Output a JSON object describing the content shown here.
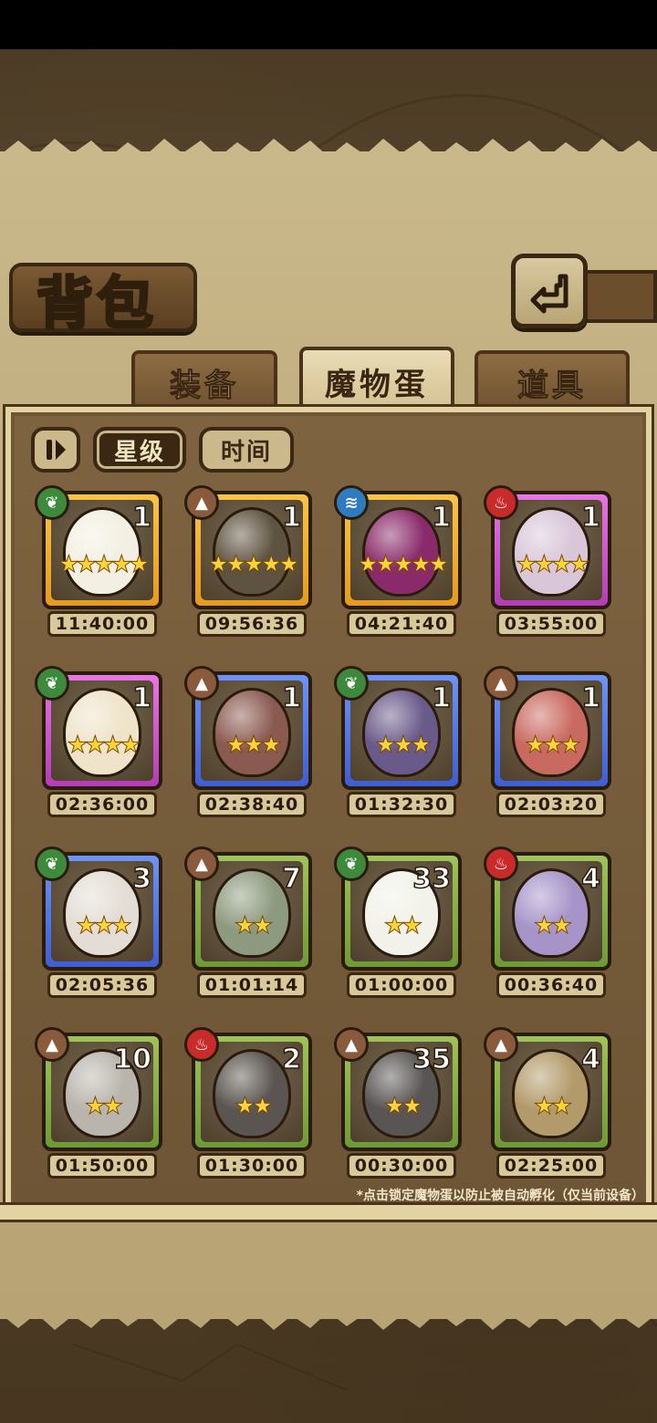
{
  "screen": {
    "title": "背包",
    "back_icon": "back-arrow-icon"
  },
  "tabs": [
    {
      "label": "装备",
      "active": false
    },
    {
      "label": "魔物蛋",
      "active": true
    },
    {
      "label": "道具",
      "active": false
    }
  ],
  "sort": {
    "toggle_icon": "sort-toggle-icon",
    "star_label": "星级",
    "time_label": "时间"
  },
  "eggs": [
    {
      "element": "grass",
      "count": "1",
      "stars": 5,
      "frame": "orange",
      "time": "11:40:00",
      "color": "#f3efe2"
    },
    {
      "element": "earth",
      "count": "1",
      "stars": 5,
      "frame": "orange",
      "time": "09:56:36",
      "color": "#5e5340"
    },
    {
      "element": "water",
      "count": "1",
      "stars": 5,
      "frame": "orange",
      "time": "04:21:40",
      "color": "#8a2a6a"
    },
    {
      "element": "fire",
      "count": "1",
      "stars": 4,
      "frame": "pink",
      "time": "03:55:00",
      "color": "#d9c6d9"
    },
    {
      "element": "grass",
      "count": "1",
      "stars": 4,
      "frame": "pink",
      "time": "02:36:00",
      "color": "#efe3c9"
    },
    {
      "element": "earth",
      "count": "1",
      "stars": 3,
      "frame": "blue",
      "time": "02:38:40",
      "color": "#8a5a50"
    },
    {
      "element": "grass",
      "count": "1",
      "stars": 3,
      "frame": "blue",
      "time": "01:32:30",
      "color": "#6a5a8a"
    },
    {
      "element": "earth",
      "count": "1",
      "stars": 3,
      "frame": "blue",
      "time": "02:03:20",
      "color": "#c96a60"
    },
    {
      "element": "grass",
      "count": "3",
      "stars": 3,
      "frame": "blue",
      "time": "02:05:36",
      "color": "#e3ddd5"
    },
    {
      "element": "earth",
      "count": "7",
      "stars": 2,
      "frame": "green",
      "time": "01:01:14",
      "color": "#8e9a80"
    },
    {
      "element": "grass",
      "count": "33",
      "stars": 2,
      "frame": "green",
      "time": "01:00:00",
      "color": "#f2f2ea"
    },
    {
      "element": "fire",
      "count": "4",
      "stars": 2,
      "frame": "green",
      "time": "00:36:40",
      "color": "#a694c9"
    },
    {
      "element": "earth",
      "count": "10",
      "stars": 2,
      "frame": "green",
      "time": "01:50:00",
      "color": "#b9b5ad"
    },
    {
      "element": "fire",
      "count": "2",
      "stars": 2,
      "frame": "green",
      "time": "01:30:00",
      "color": "#5a5550"
    },
    {
      "element": "earth",
      "count": "35",
      "stars": 2,
      "frame": "green",
      "time": "00:30:00",
      "color": "#5a5555"
    },
    {
      "element": "earth",
      "count": "4",
      "stars": 2,
      "frame": "green",
      "time": "02:25:00",
      "color": "#b39a6a"
    }
  ],
  "footnote": "*点击锁定魔物蛋以防止被自动孵化（仅当前设备）"
}
